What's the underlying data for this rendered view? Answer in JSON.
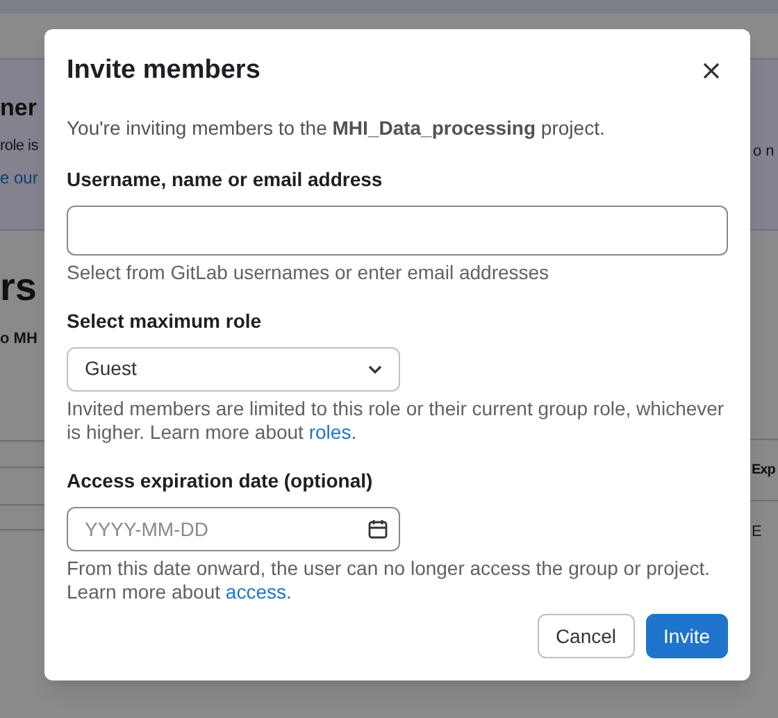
{
  "background": {
    "left": [
      {
        "kind": "heading",
        "text": "ner"
      },
      {
        "kind": "text",
        "text": "role is"
      },
      {
        "kind": "link",
        "text": "e our"
      },
      {
        "kind": "title",
        "text": "rs"
      },
      {
        "kind": "bold",
        "text": "o MH"
      }
    ],
    "right": [
      {
        "kind": "text",
        "text": "o n"
      },
      {
        "kind": "bold",
        "text": "Exp"
      },
      {
        "kind": "text",
        "text": "E"
      }
    ]
  },
  "modal": {
    "title": "Invite members",
    "description": "You're inviting members to the **MHI_Data_processing** project.",
    "fields": [
      {
        "kind": "text",
        "label": "Username, name or email address",
        "help": "Select from GitLab usernames or enter email addresses"
      },
      {
        "kind": "select",
        "label": "Select maximum role",
        "value": "Guest",
        "help": "Invited members are limited to this role or their current group role, whichever is higher. Learn more about ",
        "link": "roles",
        "help_end": "."
      },
      {
        "kind": "date",
        "label": "Access expiration date (optional)",
        "placeholder": "YYYY-MM-DD",
        "help": "From this date onward, the user can no longer access the group or project. Learn more about ",
        "link": "access",
        "help_end": "."
      }
    ],
    "buttons": [
      {
        "label": "Cancel",
        "kind": "secondary"
      },
      {
        "label": "Invite",
        "kind": "primary"
      }
    ]
  }
}
